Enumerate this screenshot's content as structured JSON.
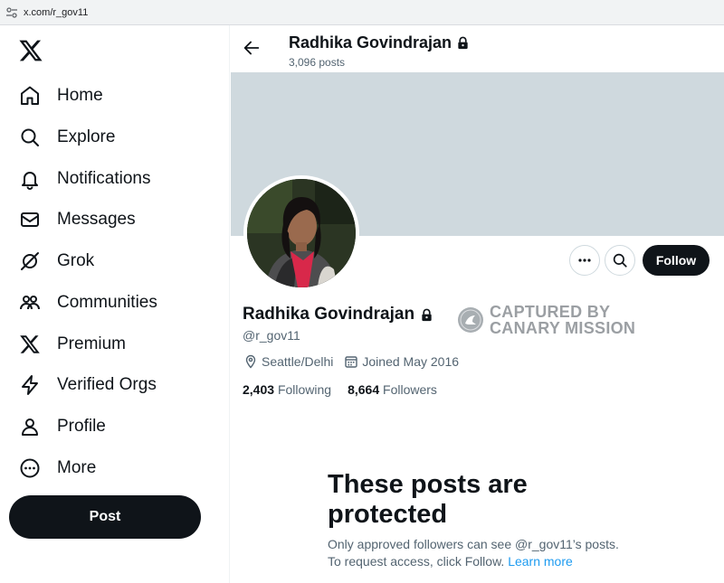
{
  "browser": {
    "url": "x.com/r_gov11"
  },
  "sidebar": {
    "items": [
      {
        "label": "Home",
        "icon": "home-icon"
      },
      {
        "label": "Explore",
        "icon": "search-icon"
      },
      {
        "label": "Notifications",
        "icon": "bell-icon"
      },
      {
        "label": "Messages",
        "icon": "envelope-icon"
      },
      {
        "label": "Grok",
        "icon": "grok-icon"
      },
      {
        "label": "Communities",
        "icon": "people-icon"
      },
      {
        "label": "Premium",
        "icon": "x-logo-icon"
      },
      {
        "label": "Verified Orgs",
        "icon": "lightning-icon"
      },
      {
        "label": "Profile",
        "icon": "person-icon"
      },
      {
        "label": "More",
        "icon": "more-circle-icon"
      }
    ],
    "post_label": "Post"
  },
  "header": {
    "name": "Radhika Govindrajan",
    "posts": "3,096 posts"
  },
  "profile": {
    "name": "Radhika Govindrajan",
    "handle": "@r_gov11",
    "location": "Seattle/Delhi",
    "joined": "Joined May 2016",
    "following_count": "2,403",
    "following_label": "Following",
    "followers_count": "8,664",
    "followers_label": "Followers",
    "follow_label": "Follow"
  },
  "watermark": {
    "line1": "CAPTURED BY",
    "line2": "CANARY MISSION"
  },
  "protected": {
    "title_line1": "These posts are",
    "title_line2": "protected",
    "body_line1": "Only approved followers can see @r_gov11’s posts.",
    "body_line2": "To request access, click Follow.",
    "link": "Learn more"
  },
  "colors": {
    "accent": "#1d9bf0",
    "banner": "#cfd9de",
    "text": "#0f1419",
    "muted": "#536471"
  }
}
